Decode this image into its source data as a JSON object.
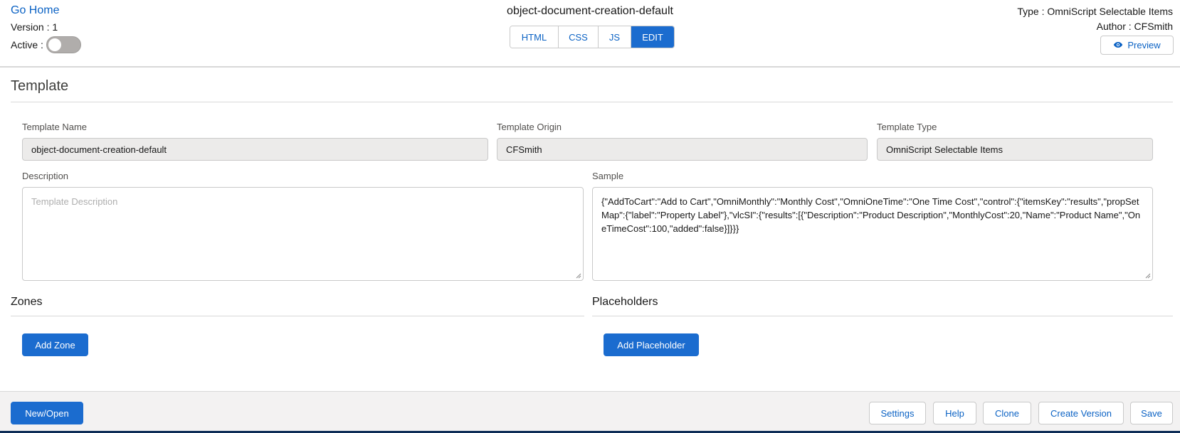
{
  "header": {
    "go_home": "Go Home",
    "version": "Version : 1",
    "active_label": "Active :",
    "active_on": false,
    "title": "object-document-creation-default",
    "tabs": [
      "HTML",
      "CSS",
      "JS",
      "EDIT"
    ],
    "active_tab": "EDIT",
    "type": "Type : OmniScript Selectable Items",
    "author": "Author : CFSmith",
    "preview": "Preview"
  },
  "template": {
    "section_title": "Template",
    "name_label": "Template Name",
    "name_value": "object-document-creation-default",
    "origin_label": "Template Origin",
    "origin_value": "CFSmith",
    "type_label": "Template Type",
    "type_value": "OmniScript Selectable Items",
    "description_label": "Description",
    "description_placeholder": "Template Description",
    "sample_label": "Sample",
    "sample_value": "{\"AddToCart\":\"Add to Cart\",\"OmniMonthly\":\"Monthly Cost\",\"OmniOneTime\":\"One Time Cost\",\"control\":{\"itemsKey\":\"results\",\"propSetMap\":{\"label\":\"Property Label\"},\"vlcSI\":{\"results\":[{\"Description\":\"Product Description\",\"MonthlyCost\":20,\"Name\":\"Product Name\",\"OneTimeCost\":100,\"added\":false}]}}}"
  },
  "zones": {
    "title": "Zones",
    "add_button": "Add Zone"
  },
  "placeholders": {
    "title": "Placeholders",
    "add_button": "Add Placeholder"
  },
  "footer": {
    "new_open": "New/Open",
    "settings": "Settings",
    "help": "Help",
    "clone": "Clone",
    "create_version": "Create Version",
    "save": "Save"
  },
  "colors": {
    "brand": "#1b6ccf",
    "link": "#0b62c4",
    "readonly_bg": "#ecebea",
    "footer_bg": "#f3f2f2"
  }
}
